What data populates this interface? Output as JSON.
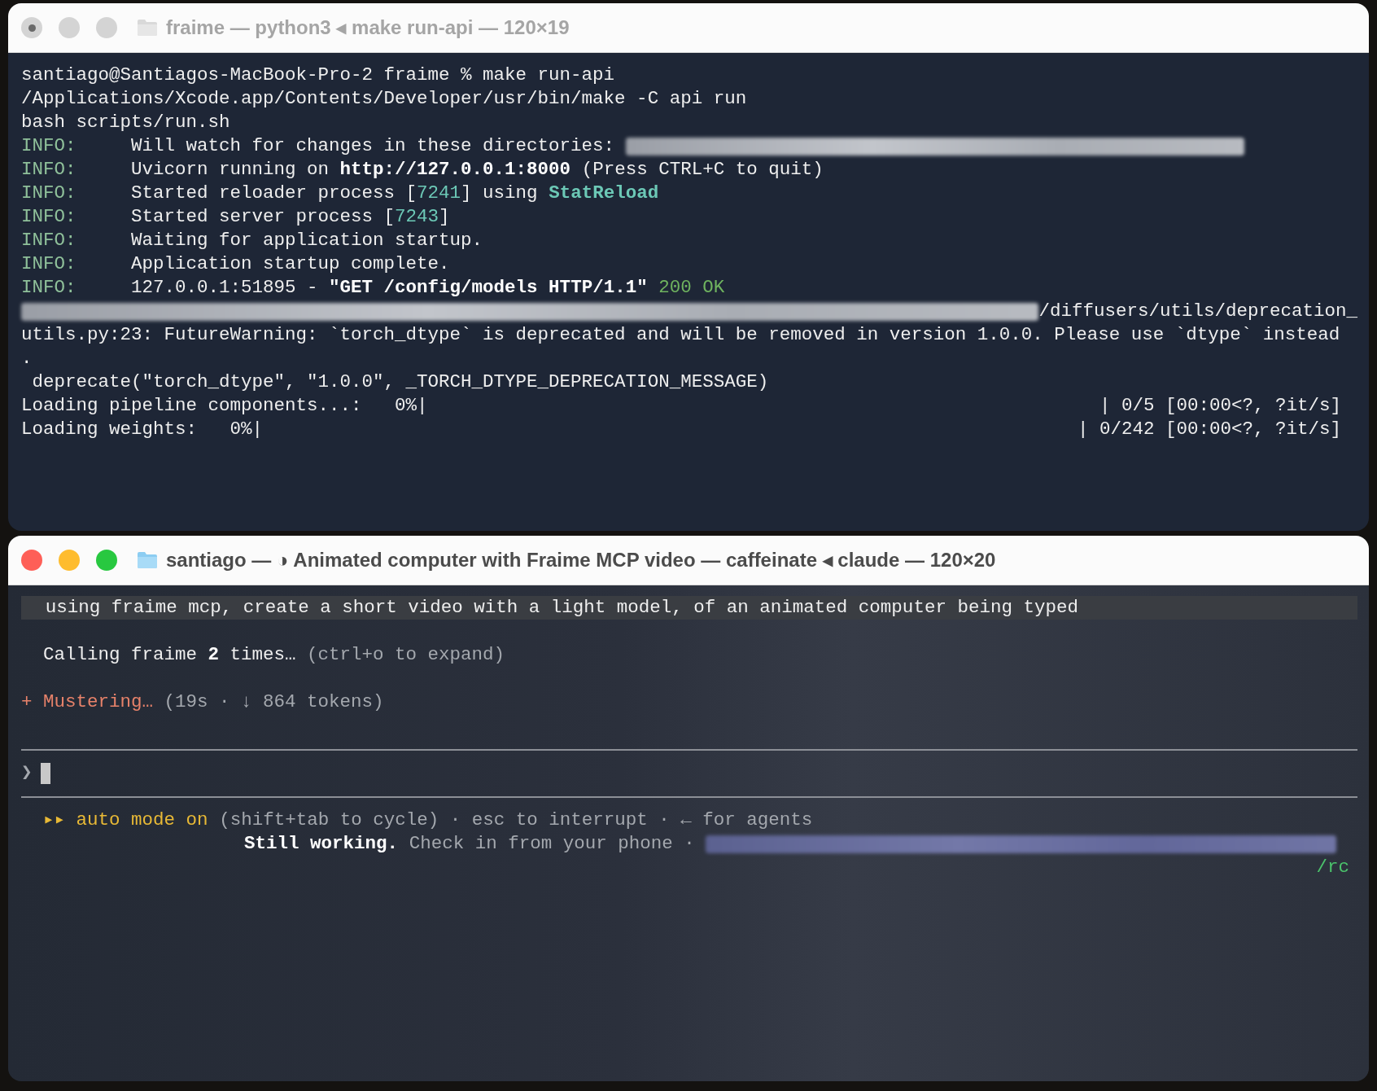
{
  "windows": [
    {
      "title": "fraime — python3 ◂ make run-api — 120×19",
      "active": false,
      "lines": [
        {
          "kind": "text",
          "segments": [
            {
              "text": "santiago@Santiagos-MacBook-Pro-2 fraime % make run-api",
              "kind": "plain"
            }
          ]
        },
        {
          "kind": "text",
          "segments": [
            {
              "text": "/Applications/Xcode.app/Contents/Developer/usr/bin/make -C api run",
              "kind": "plain"
            }
          ]
        },
        {
          "kind": "text",
          "segments": [
            {
              "text": "bash scripts/run.sh",
              "kind": "plain"
            }
          ]
        },
        {
          "kind": "text",
          "segments": [
            {
              "text": "INFO:",
              "kind": "info"
            },
            {
              "text": "     Will watch for changes in these directories: ",
              "kind": "plain"
            },
            {
              "kind": "redacted"
            }
          ]
        },
        {
          "kind": "text",
          "segments": [
            {
              "text": "INFO:",
              "kind": "info"
            },
            {
              "text": "     Uvicorn running on ",
              "kind": "plain"
            },
            {
              "text": "http://127.0.0.1:8000",
              "kind": "bold"
            },
            {
              "text": " (Press CTRL+C to quit)",
              "kind": "plain"
            }
          ]
        },
        {
          "kind": "text",
          "segments": [
            {
              "text": "INFO:",
              "kind": "info"
            },
            {
              "text": "     Started reloader process [",
              "kind": "plain"
            },
            {
              "text": "7241",
              "kind": "teal"
            },
            {
              "text": "] using ",
              "kind": "plain"
            },
            {
              "text": "StatReload",
              "kind": "tealbold"
            }
          ]
        },
        {
          "kind": "text",
          "segments": [
            {
              "text": "INFO:",
              "kind": "info"
            },
            {
              "text": "     Started server process [",
              "kind": "plain"
            },
            {
              "text": "7243",
              "kind": "teal"
            },
            {
              "text": "]",
              "kind": "plain"
            }
          ]
        },
        {
          "kind": "text",
          "segments": [
            {
              "text": "INFO:",
              "kind": "info"
            },
            {
              "text": "     Waiting for application startup.",
              "kind": "plain"
            }
          ]
        },
        {
          "kind": "text",
          "segments": [
            {
              "text": "INFO:",
              "kind": "info"
            },
            {
              "text": "     Application startup complete.",
              "kind": "plain"
            }
          ]
        },
        {
          "kind": "text",
          "segments": [
            {
              "text": "INFO:",
              "kind": "info"
            },
            {
              "text": "     127.0.0.1:51895 - ",
              "kind": "plain"
            },
            {
              "text": "\"GET /config/models HTTP/1.1\"",
              "kind": "bold"
            },
            {
              "text": " 200 OK",
              "kind": "ok"
            }
          ]
        },
        {
          "kind": "text",
          "segments": [
            {
              "kind": "redacted"
            },
            {
              "text": "/diffusers/utils/deprecation_",
              "kind": "plain"
            }
          ]
        },
        {
          "kind": "text",
          "segments": [
            {
              "text": "utils.py:23: FutureWarning: `torch_dtype` is deprecated and will be removed in version 1.0.0. Please use `dtype` instead",
              "kind": "plain"
            }
          ]
        },
        {
          "kind": "text",
          "segments": [
            {
              "text": ".",
              "kind": "plain"
            }
          ]
        },
        {
          "kind": "text",
          "segments": [
            {
              "text": " deprecate(\"torch_dtype\", \"1.0.0\", _TORCH_DTYPE_DEPRECATION_MESSAGE)",
              "kind": "plain"
            }
          ]
        },
        {
          "kind": "progress",
          "segments": [
            {
              "text": "Loading pipeline components...:   0%|",
              "kind": "plain"
            },
            {
              "text": "| 0/5 [00:00<?, ?it/s]",
              "kind": "plain"
            }
          ]
        },
        {
          "kind": "progress",
          "segments": [
            {
              "text": "Loading weights:   0%|",
              "kind": "plain"
            },
            {
              "text": "| 0/242 [00:00<?, ?it/s]",
              "kind": "plain"
            }
          ]
        }
      ]
    },
    {
      "title": "santiago — ◑ Animated computer with Fraime MCP video — caffeinate ◂ claude — 120×20",
      "active": true,
      "lines": [
        {
          "kind": "prompt",
          "segments": [
            {
              "text": "using fraime mcp, create a short video with a light model, of an animated computer being typed",
              "kind": "plain"
            }
          ]
        },
        {
          "kind": "blank"
        },
        {
          "kind": "indented",
          "segments": [
            {
              "text": "Calling fraime ",
              "kind": "plain"
            },
            {
              "text": "2",
              "kind": "bold"
            },
            {
              "text": " times…",
              "kind": "plain"
            },
            {
              "text": " (ctrl+o to expand)",
              "kind": "dim"
            }
          ]
        },
        {
          "kind": "blank"
        },
        {
          "kind": "text",
          "segments": [
            {
              "text": "+ Mustering…",
              "kind": "orange"
            },
            {
              "text": " (19s · ↓ 864 tokens)",
              "kind": "dim"
            }
          ]
        },
        {
          "kind": "blank"
        },
        {
          "kind": "rule"
        },
        {
          "kind": "input",
          "segments": [
            {
              "text": "❯",
              "kind": "dim"
            }
          ]
        },
        {
          "kind": "rule"
        },
        {
          "kind": "indented",
          "segments": [
            {
              "text": "▸▸ auto mode on",
              "kind": "yellow"
            },
            {
              "text": " (shift+tab to cycle) · esc to interrupt · ← for agents",
              "kind": "dim"
            }
          ]
        },
        {
          "kind": "status",
          "segments": [
            {
              "text": "Still working.",
              "kind": "bold"
            },
            {
              "text": " Check in from your phone · ",
              "kind": "dim"
            },
            {
              "kind": "redacted"
            }
          ]
        },
        {
          "kind": "right",
          "segments": [
            {
              "text": "/rc",
              "kind": "green"
            }
          ]
        }
      ]
    }
  ]
}
